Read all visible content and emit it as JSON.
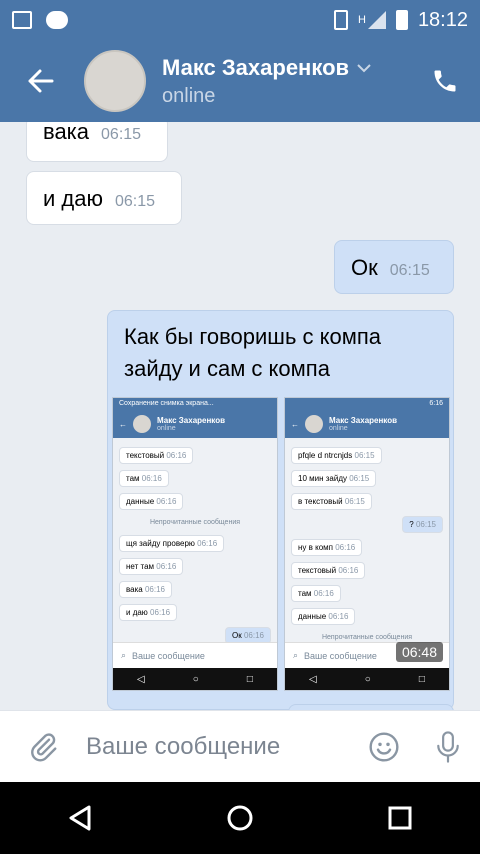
{
  "status_bar": {
    "time": "18:12",
    "network": "H"
  },
  "header": {
    "name": "Макс Захаренков",
    "status": "online"
  },
  "messages": [
    {
      "text": "вака",
      "time": "06:15",
      "dir": "in"
    },
    {
      "text": "и даю",
      "time": "06:15",
      "dir": "in"
    },
    {
      "text": "Ок",
      "time": "06:15",
      "dir": "out"
    }
  ],
  "card": {
    "text": "Как бы говоришь с компа зайду и сам с компа",
    "shot1": {
      "status_text": "Сохранение снимка экрана...",
      "name": "Макс Захаренков",
      "online": "online",
      "items": [
        {
          "text": "текстовый",
          "time": "06:16"
        },
        {
          "text": "там",
          "time": "06:16"
        },
        {
          "text": "данные",
          "time": "06:16"
        }
      ],
      "separator": "Непрочитанные сообщения",
      "items2": [
        {
          "text": "щя зайду проверю",
          "time": "06:16"
        },
        {
          "text": "нет там",
          "time": "06:16"
        },
        {
          "text": "вака",
          "time": "06:16"
        },
        {
          "text": "и даю",
          "time": "06:16"
        }
      ],
      "out": {
        "text": "Ок",
        "time": "06:16"
      },
      "input_placeholder": "Ваше сообщение"
    },
    "shot2": {
      "status_time": "6:16",
      "name": "Макс Захаренков",
      "online": "online",
      "items": [
        {
          "text": "pfqle d ntrcnjds",
          "time": "06:15"
        },
        {
          "text": "10 мин зайду",
          "time": "06:15"
        },
        {
          "text": "в текстовый",
          "time": "06:15"
        }
      ],
      "out": {
        "text": "?",
        "time": "06:15"
      },
      "items2": [
        {
          "text": "ну в комп",
          "time": "06:16"
        },
        {
          "text": "текстовый",
          "time": "06:16"
        },
        {
          "text": "там",
          "time": "06:16"
        },
        {
          "text": "данные",
          "time": "06:16"
        }
      ],
      "separator": "Непрочитанные сообщения",
      "input_placeholder": "Ваше сообщение",
      "video_time": "06:48"
    }
  },
  "input": {
    "placeholder": "Ваше сообщение"
  },
  "colors": {
    "header_bg": "#4a76a8",
    "outgoing_bubble": "#cfe0f7",
    "chat_bg": "#e9edf2"
  },
  "icons": [
    "image-icon",
    "chat-bubble-icon",
    "vibrate-icon",
    "signal-icon",
    "battery-icon",
    "back-arrow-icon",
    "phone-icon",
    "chevron-down-icon",
    "paperclip-icon",
    "smiley-icon",
    "microphone-icon",
    "nav-back-icon",
    "nav-home-icon",
    "nav-recents-icon"
  ]
}
